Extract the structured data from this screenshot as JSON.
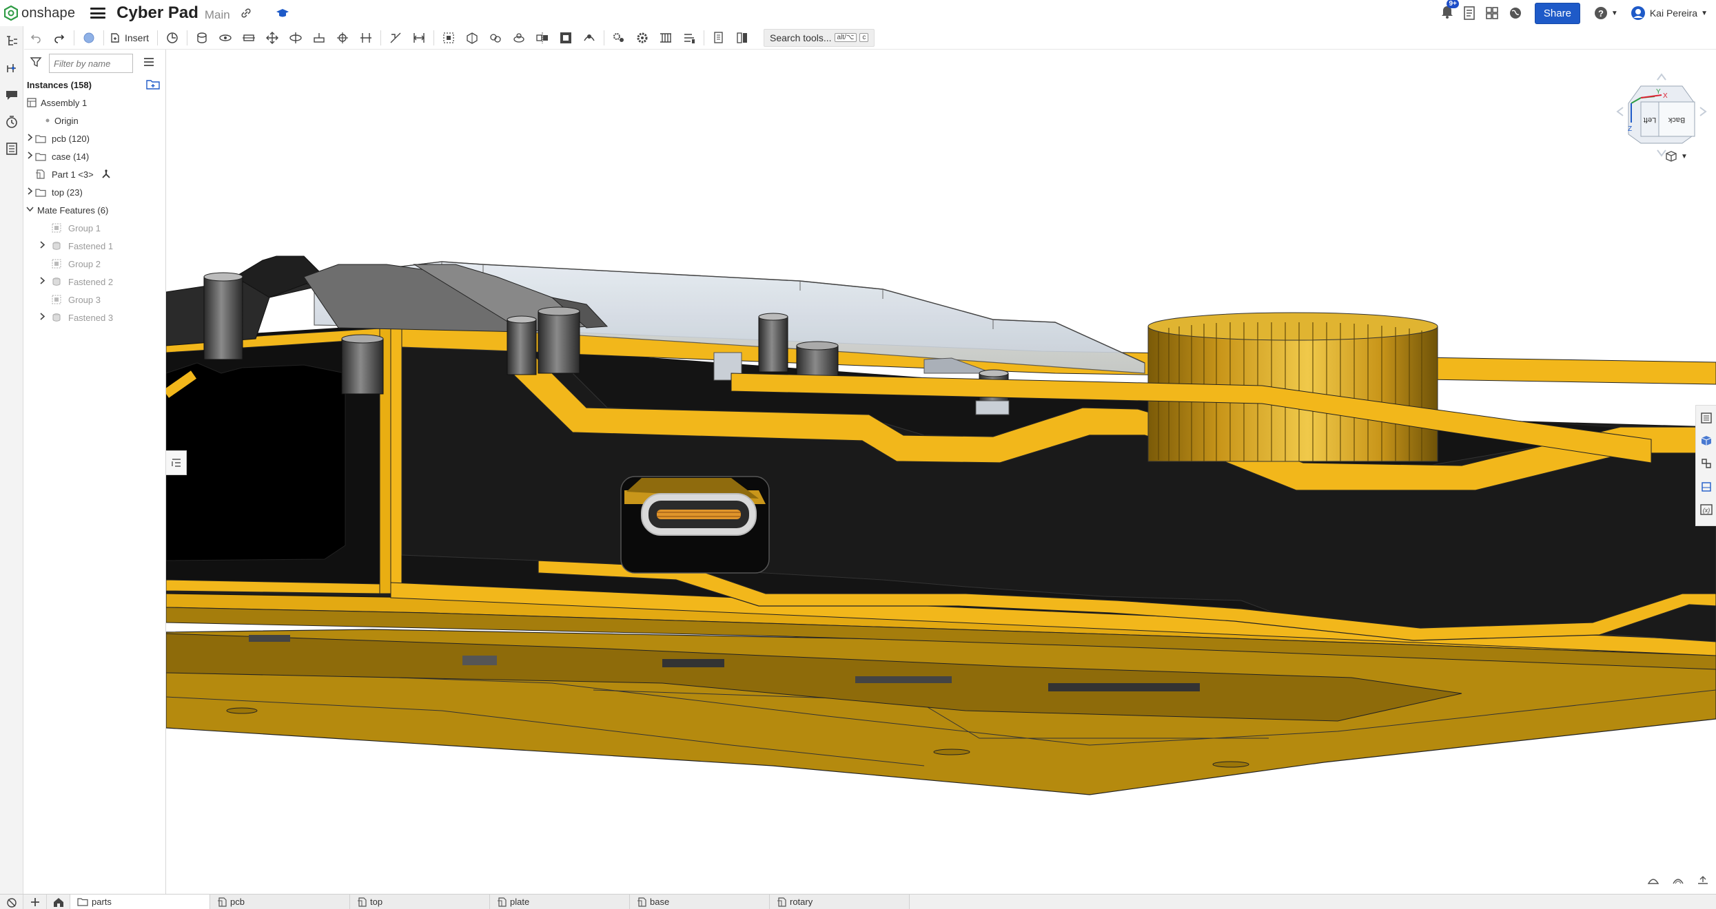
{
  "topbar": {
    "logo_text": "onshape",
    "doc_title": "Cyber Pad",
    "branch": "Main",
    "notification_count": "9+",
    "share_label": "Share",
    "user_name": "Kai Pereira"
  },
  "toolbar": {
    "insert_label": "Insert",
    "search_label": "Search tools...",
    "shortcut_1": "alt/⌥",
    "shortcut_2": "c"
  },
  "panel": {
    "filter_placeholder": "Filter by name",
    "instances_header": "Instances (158)",
    "tree": [
      {
        "label": "Assembly 1",
        "level": 0,
        "icon": "assembly-icon",
        "chevron": false,
        "dim": false
      },
      {
        "label": "Origin",
        "level": 1,
        "icon": "origin-dot-icon",
        "chevron": false,
        "dim": false
      },
      {
        "label": "pcb (120)",
        "level": 1,
        "icon": "folder-icon",
        "chevron": "right",
        "dim": false
      },
      {
        "label": "case (14)",
        "level": 1,
        "icon": "folder-icon",
        "chevron": "right",
        "dim": false
      },
      {
        "label": "Part 1 <3>",
        "level": 1,
        "icon": "part-icon",
        "chevron": false,
        "dim": false,
        "extra": "fixed-icon"
      },
      {
        "label": "top (23)",
        "level": 1,
        "icon": "folder-icon",
        "chevron": "right",
        "dim": false
      },
      {
        "label": "Mate Features (6)",
        "level": 1,
        "icon": "",
        "chevron": "down",
        "dim": false
      },
      {
        "label": "Group 1",
        "level": 2,
        "icon": "group-icon",
        "chevron": false,
        "dim": true
      },
      {
        "label": "Fastened 1",
        "level": 2,
        "icon": "fastened-icon",
        "chevron": "right",
        "dim": true
      },
      {
        "label": "Group 2",
        "level": 2,
        "icon": "group-icon",
        "chevron": false,
        "dim": true
      },
      {
        "label": "Fastened 2",
        "level": 2,
        "icon": "fastened-icon",
        "chevron": "right",
        "dim": true
      },
      {
        "label": "Group 3",
        "level": 2,
        "icon": "group-icon",
        "chevron": false,
        "dim": true
      },
      {
        "label": "Fastened 3",
        "level": 2,
        "icon": "fastened-icon",
        "chevron": "right",
        "dim": true
      }
    ]
  },
  "viewcube": {
    "face_left": "Left",
    "face_back": "Back",
    "axis_y": "Y",
    "axis_x": "X",
    "axis_z": "Z"
  },
  "tabs": [
    {
      "label": "parts",
      "icon": "folder-icon",
      "active": true
    },
    {
      "label": "pcb",
      "icon": "part-studio-icon",
      "active": false
    },
    {
      "label": "top",
      "icon": "part-studio-icon",
      "active": false
    },
    {
      "label": "plate",
      "icon": "part-studio-icon",
      "active": false
    },
    {
      "label": "base",
      "icon": "part-studio-icon",
      "active": false
    },
    {
      "label": "rotary",
      "icon": "part-studio-icon",
      "active": false
    }
  ],
  "colors": {
    "accent": "#1e5ac8",
    "gold": "#f2b71b",
    "gold_dark": "#b78a0e",
    "body_black": "#1c1c1c",
    "clear_part": "#d6dde6"
  }
}
